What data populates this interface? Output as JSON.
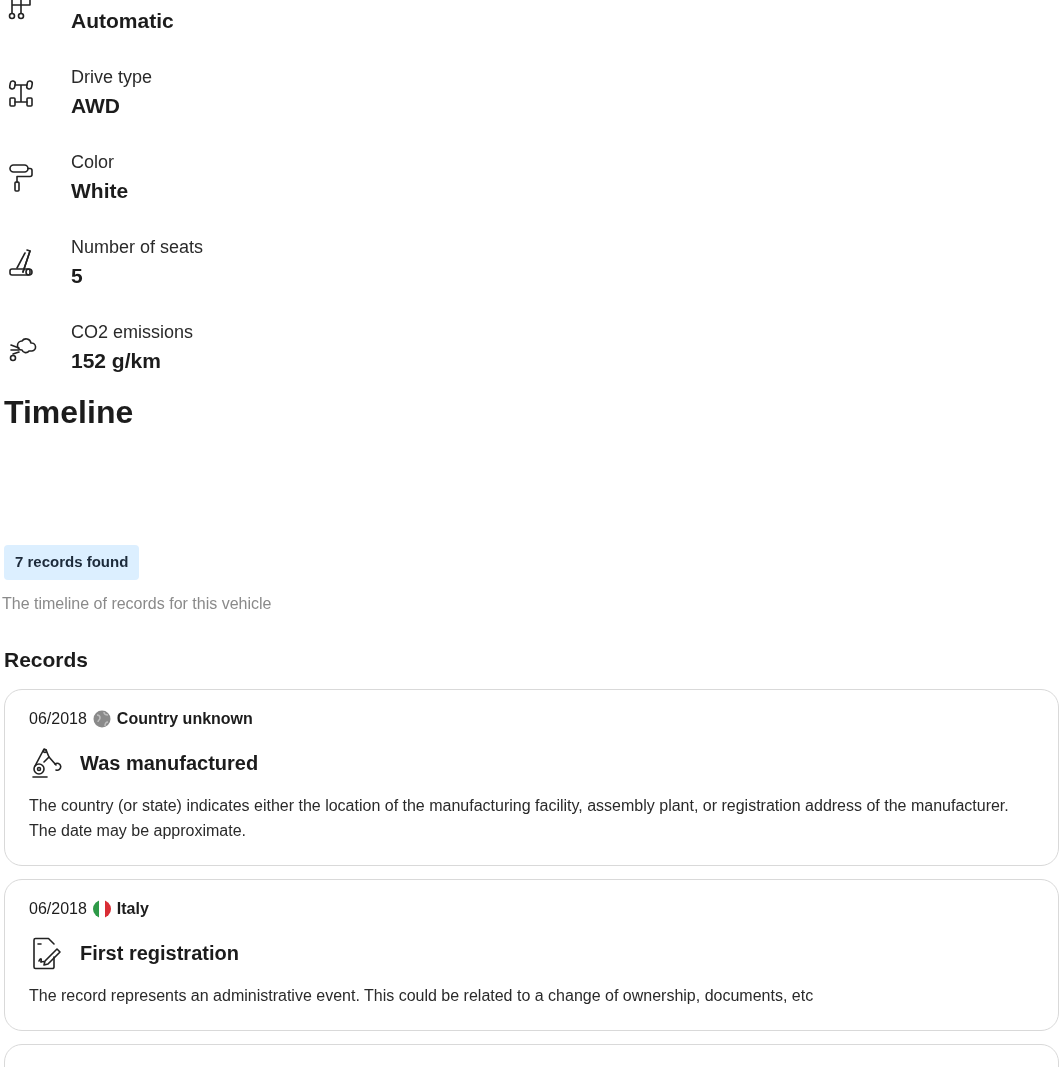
{
  "specs": [
    {
      "kind": "transmission",
      "value": "Automatic"
    },
    {
      "kind": "drive",
      "label": "Drive type",
      "value": "AWD"
    },
    {
      "kind": "color",
      "label": "Color",
      "value": "White"
    },
    {
      "kind": "seats",
      "label": "Number of seats",
      "value": "5"
    },
    {
      "kind": "co2",
      "label": "CO2 emissions",
      "value": "152 g/km"
    }
  ],
  "timeline": {
    "title": "Timeline",
    "badge": "7 records found",
    "subtitle": "The timeline of records for this vehicle",
    "records_heading": "Records",
    "records": [
      {
        "date": "06/2018",
        "country": {
          "kind": "unknown",
          "name": "Country unknown"
        },
        "event": {
          "kind": "manufacture",
          "title": "Was manufactured"
        },
        "description": "The country (or state) indicates either the location of the manufacturing facility, assembly plant, or registration address of the manufacturer. The date may be approximate."
      },
      {
        "date": "06/2018",
        "country": {
          "kind": "italy",
          "name": "Italy"
        },
        "event": {
          "kind": "registration",
          "title": "First registration"
        },
        "description": "The record represents an administrative event. This could be related to a change of ownership, documents, etc"
      }
    ]
  }
}
